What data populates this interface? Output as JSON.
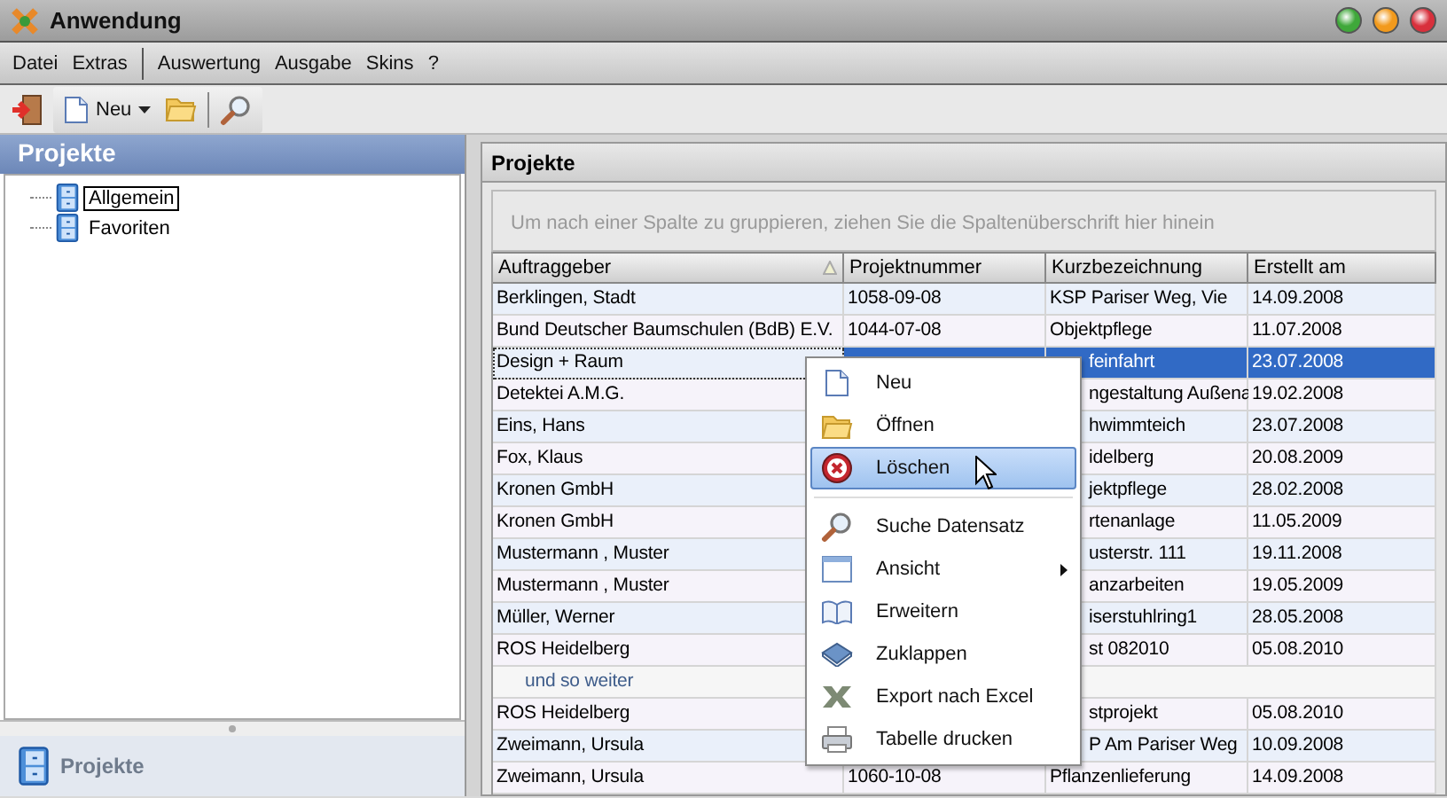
{
  "window": {
    "title": "Anwendung"
  },
  "menu_bar": [
    [
      "Datei",
      "Extras"
    ],
    [
      "Auswertung",
      "Ausgabe",
      "Skins",
      "?"
    ]
  ],
  "toolbar": {
    "new_label": "Neu"
  },
  "sidebar": {
    "title": "Projekte",
    "tree": [
      {
        "label": "Allgemein",
        "selected": true
      },
      {
        "label": "Favoriten",
        "selected": false
      }
    ],
    "nav_label": "Projekte"
  },
  "grid": {
    "title": "Projekte",
    "group_hint": "Um nach einer Spalte zu gruppieren, ziehen Sie die Spaltenüberschrift hier hinein",
    "columns": [
      {
        "label": "Auftraggeber",
        "sorted": true
      },
      {
        "label": "Projektnummer",
        "sorted": false
      },
      {
        "label": "Kurzbezeichnung",
        "sorted": false
      },
      {
        "label": "Erstellt am",
        "sorted": false
      }
    ],
    "rows": [
      {
        "kind": "data",
        "selected": false,
        "covered": false,
        "cells": [
          "Berklingen, Stadt",
          "1058-09-08",
          "KSP Pariser Weg, Vie",
          "14.09.2008"
        ]
      },
      {
        "kind": "data",
        "selected": false,
        "covered": false,
        "cells": [
          "Bund Deutscher Baumschulen (BdB) E.V.",
          "1044-07-08",
          "Objektpflege",
          "11.07.2008"
        ]
      },
      {
        "kind": "data",
        "selected": true,
        "covered": true,
        "cells": [
          "Design + Raum",
          "",
          "feinfahrt",
          "23.07.2008"
        ]
      },
      {
        "kind": "data",
        "selected": false,
        "covered": true,
        "cells": [
          "Detektei A.M.G.",
          "",
          "ngestaltung Außena",
          "19.02.2008"
        ]
      },
      {
        "kind": "data",
        "selected": false,
        "covered": true,
        "cells": [
          "Eins, Hans",
          "",
          "hwimmteich",
          "23.07.2008"
        ]
      },
      {
        "kind": "data",
        "selected": false,
        "covered": true,
        "cells": [
          "Fox, Klaus",
          "",
          "idelberg",
          "20.08.2009"
        ]
      },
      {
        "kind": "data",
        "selected": false,
        "covered": true,
        "cells": [
          "Kronen GmbH",
          "",
          "jektpflege",
          "28.02.2008"
        ]
      },
      {
        "kind": "data",
        "selected": false,
        "covered": true,
        "cells": [
          "Kronen GmbH",
          "",
          "rtenanlage",
          "11.05.2009"
        ]
      },
      {
        "kind": "data",
        "selected": false,
        "covered": true,
        "cells": [
          "Mustermann , Muster",
          "",
          "usterstr. 111",
          "19.11.2008"
        ]
      },
      {
        "kind": "data",
        "selected": false,
        "covered": true,
        "cells": [
          "Mustermann , Muster",
          "",
          "anzarbeiten",
          "19.05.2009"
        ]
      },
      {
        "kind": "data",
        "selected": false,
        "covered": true,
        "cells": [
          "Müller, Werner",
          "",
          "iserstuhlring1",
          "28.05.2008"
        ]
      },
      {
        "kind": "data",
        "selected": false,
        "covered": true,
        "cells": [
          "ROS Heidelberg",
          "",
          "st 082010",
          "05.08.2010"
        ]
      },
      {
        "kind": "note",
        "cells": [
          "und so weiter"
        ]
      },
      {
        "kind": "data",
        "selected": false,
        "covered": true,
        "cells": [
          "ROS Heidelberg",
          "",
          "stprojekt",
          "05.08.2010"
        ]
      },
      {
        "kind": "data",
        "selected": false,
        "covered": true,
        "cells": [
          "Zweimann, Ursula",
          "",
          "P Am Pariser Weg",
          "10.09.2008"
        ]
      },
      {
        "kind": "data",
        "selected": false,
        "covered": false,
        "cells": [
          "Zweimann, Ursula",
          "1060-10-08",
          "Pflanzenlieferung",
          "14.09.2008"
        ]
      }
    ]
  },
  "context_menu": [
    {
      "label": "Neu",
      "kind": "new",
      "selected": false
    },
    {
      "label": "Öffnen",
      "kind": "open",
      "selected": false
    },
    {
      "label": "Löschen",
      "kind": "delete",
      "selected": true
    },
    {
      "label": "Suche Datensatz",
      "kind": "search",
      "selected": false
    },
    {
      "label": "Ansicht",
      "kind": "view",
      "selected": false
    },
    {
      "label": "Erweitern",
      "kind": "expand",
      "selected": false
    },
    {
      "label": "Zuklappen",
      "kind": "collapse",
      "selected": false
    },
    {
      "label": "Export nach Excel",
      "kind": "excel",
      "selected": false
    },
    {
      "label": "Tabelle drucken",
      "kind": "print",
      "selected": false
    }
  ]
}
